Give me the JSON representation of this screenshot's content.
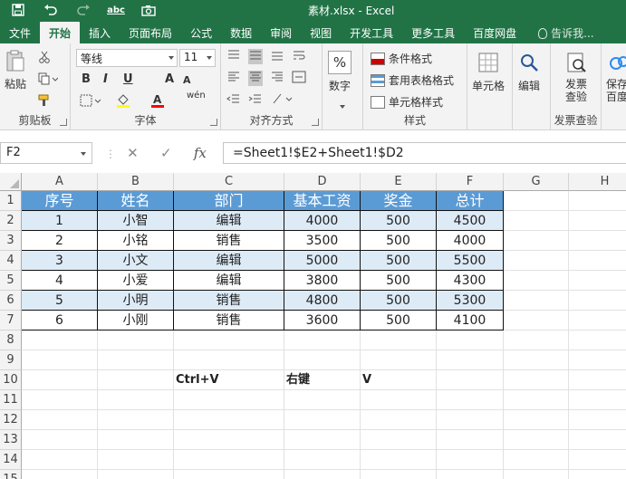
{
  "title_bar": {
    "title": "素材.xlsx - Excel",
    "qat_spell": "abc"
  },
  "tabs": [
    {
      "label": "文件",
      "active": false
    },
    {
      "label": "开始",
      "active": true
    },
    {
      "label": "插入",
      "active": false
    },
    {
      "label": "页面布局",
      "active": false
    },
    {
      "label": "公式",
      "active": false
    },
    {
      "label": "数据",
      "active": false
    },
    {
      "label": "审阅",
      "active": false
    },
    {
      "label": "视图",
      "active": false
    },
    {
      "label": "开发工具",
      "active": false
    },
    {
      "label": "更多工具",
      "active": false
    },
    {
      "label": "百度网盘",
      "active": false
    }
  ],
  "tell_me": "告诉我...",
  "ribbon": {
    "clipboard": {
      "label": "剪贴板",
      "paste": "粘贴"
    },
    "font": {
      "label": "字体",
      "font_name": "等线",
      "font_size": "11",
      "bold": "B",
      "italic": "I",
      "underline": "U",
      "grow": "A",
      "shrink": "A",
      "wen": "wén"
    },
    "alignment": {
      "label": "对齐方式"
    },
    "number": {
      "label": "数字",
      "symbol": "%"
    },
    "styles": {
      "label": "样式",
      "conditional": "条件格式",
      "table_format": "套用表格格式",
      "cell_style": "单元格样式"
    },
    "cells": {
      "label": "单元格"
    },
    "editing": {
      "label": "编辑"
    },
    "invoice": {
      "label": "发票查验",
      "button": "发票查验"
    },
    "save": {
      "button": "保存百度"
    }
  },
  "formula_bar": {
    "name_box": "F2",
    "cancel": "✕",
    "enter": "✓",
    "fx": "fx",
    "formula": "=Sheet1!$E2+Sheet1!$D2"
  },
  "sheet": {
    "columns": [
      "A",
      "B",
      "C",
      "D",
      "E",
      "F",
      "G",
      "H"
    ],
    "rows": [
      "1",
      "2",
      "3",
      "4",
      "5",
      "6",
      "7",
      "8",
      "9",
      "10",
      "11",
      "12",
      "13",
      "14",
      "15"
    ],
    "header": [
      "序号",
      "姓名",
      "部门",
      "基本工资",
      "奖金",
      "总计"
    ],
    "data": [
      [
        "1",
        "小智",
        "编辑",
        "4000",
        "500",
        "4500"
      ],
      [
        "2",
        "小铭",
        "销售",
        "3500",
        "500",
        "4000"
      ],
      [
        "3",
        "小文",
        "编辑",
        "5000",
        "500",
        "5500"
      ],
      [
        "4",
        "小爱",
        "编辑",
        "3800",
        "500",
        "4300"
      ],
      [
        "5",
        "小明",
        "销售",
        "4800",
        "500",
        "5300"
      ],
      [
        "6",
        "小刚",
        "销售",
        "3600",
        "500",
        "4100"
      ]
    ],
    "notes": {
      "c10": "Ctrl+V",
      "d10": "右键",
      "e10": "V"
    }
  },
  "colors": {
    "excel_green": "#217346",
    "table_header": "#5b9bd5",
    "table_band": "#ddebf7"
  }
}
